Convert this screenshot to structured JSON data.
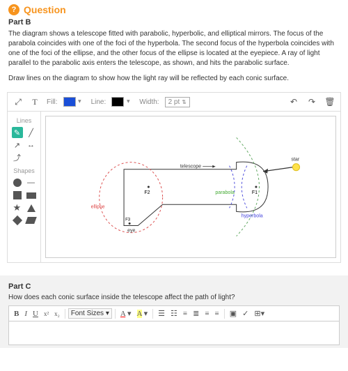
{
  "question": {
    "header": "Question",
    "partB": {
      "label": "Part B",
      "p1": "The diagram shows a telescope fitted with parabolic, hyperbolic, and elliptical mirrors. The focus of the parabola coincides with one of the foci of the hyperbola. The second focus of the hyperbola coincides with one of the foci of the ellipse, and the other focus of the ellipse is located at the eyepiece. A ray of light parallel to the parabolic axis enters the telescope, as shown, and hits the parabolic surface.",
      "p2": "Draw lines on the diagram to show how the light ray will be reflected by each conic surface."
    },
    "partC": {
      "label": "Part C",
      "prompt": "How does each conic surface inside the telescope affect the path of light?"
    }
  },
  "toolbar": {
    "fill": "Fill:",
    "line": "Line:",
    "width": "Width:",
    "widthValue": "2 pt"
  },
  "palette": {
    "lines": "Lines",
    "shapes": "Shapes"
  },
  "rte": {
    "fontSizes": "Font Sizes"
  },
  "diagram": {
    "telescope": "telescope",
    "star": "star",
    "parabola": "parabola",
    "hyperbola": "hyperbola",
    "ellipse": "ellipse",
    "eye": "eye",
    "f1": "F1",
    "f2": "F2",
    "f3": "F3"
  }
}
